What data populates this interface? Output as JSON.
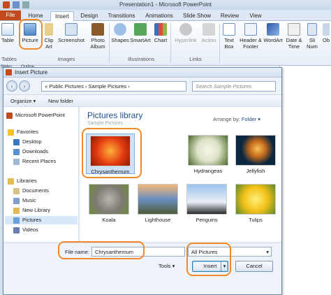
{
  "window": {
    "title": "Presentation1 - Microsoft PowerPoint"
  },
  "tabs": [
    "File",
    "Home",
    "Insert",
    "Design",
    "Transitions",
    "Animations",
    "Slide Show",
    "Review",
    "View"
  ],
  "ribbon": {
    "buttons": [
      {
        "label": "Table"
      },
      {
        "label": "Picture"
      },
      {
        "label": "Clip Art"
      },
      {
        "label": "Screenshot"
      },
      {
        "label": "Photo Album"
      },
      {
        "label": "Shapes"
      },
      {
        "label": "SmartArt"
      },
      {
        "label": "Chart"
      },
      {
        "label": "Hyperlink"
      },
      {
        "label": "Action"
      },
      {
        "label": "Text Box"
      },
      {
        "label": "Header & Footer"
      },
      {
        "label": "WordArt"
      },
      {
        "label": "Date & Time"
      },
      {
        "label": "Sli Num"
      },
      {
        "label": "Ob"
      }
    ],
    "groups": [
      "Tables",
      "Images",
      "Illustrations",
      "Links"
    ],
    "panel_tabs": [
      "Slides",
      "Outline"
    ]
  },
  "dialog": {
    "title": "Insert Picture",
    "address": "« Public Pictures › Sample Pictures ›",
    "search_placeholder": "Search Sample Pictures",
    "toolbar": {
      "organize": "Organize ▾",
      "new_folder": "New folder"
    },
    "nav": [
      {
        "label": "Microsoft PowerPoint",
        "icon": "powerpoint-icon"
      },
      {
        "label": "Favorites",
        "icon": "star-icon"
      },
      {
        "label": "Desktop",
        "icon": "desktop-icon"
      },
      {
        "label": "Downloads",
        "icon": "downloads-icon"
      },
      {
        "label": "Recent Places",
        "icon": "recent-icon"
      },
      {
        "label": "Libraries",
        "icon": "library-icon"
      },
      {
        "label": "Documents",
        "icon": "documents-icon"
      },
      {
        "label": "Music",
        "icon": "music-icon"
      },
      {
        "label": "New Library",
        "icon": "library-icon"
      },
      {
        "label": "Pictures",
        "icon": "pictures-icon"
      },
      {
        "label": "Videos",
        "icon": "videos-icon"
      }
    ],
    "library_title": "Pictures library",
    "library_sub": "Sample Pictures",
    "arrange_label": "Arrange by:",
    "arrange_value": "Folder ▾",
    "thumbnails": [
      "Chrysanthemum",
      "Hydrangeas",
      "Jellyfish",
      "Koala",
      "Lighthouse",
      "Penguins",
      "Tulips"
    ],
    "filename_label": "File name:",
    "filename_value": "Chrysanthemum",
    "filetype_value": "All Pictures",
    "tools_label": "Tools ▾",
    "insert_label": "Insert",
    "cancel_label": "Cancel"
  },
  "colors": {
    "accent": "#f08a28",
    "file_tab": "#c24a1e",
    "library_title": "#1e4e8c"
  }
}
